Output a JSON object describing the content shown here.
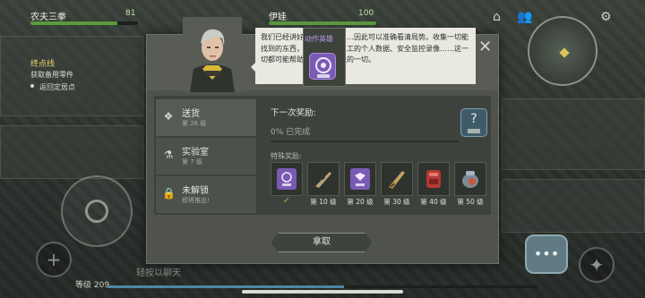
{
  "hud": {
    "player1_name": "农夫三拳",
    "player1_hp": "81",
    "player1_hp_fraction": 0.81,
    "player2_name": "伊娃",
    "player2_hp": "100",
    "player2_hp_fraction": 1.0,
    "quest_title": "终点线",
    "quest_sub": "获取备用零件",
    "quest_back": "返回定居点",
    "level": "等级 209",
    "chat_placeholder": "轻按以聊天"
  },
  "dialog": {
    "speech": "我们已经讲好了所有工作……因此可以准确看清局势。收集一切能找到的东西，研究完成、员工的个人数据、安全监控录像……这一切都可能帮助我们重现发生的一切。",
    "tooltip_label": "动作英雄",
    "close_icon": "close-icon",
    "tabs": [
      {
        "title": "送货",
        "sub": "第 26 级",
        "icon": "box-icon"
      },
      {
        "title": "实验室",
        "sub": "第 7 级",
        "icon": "flask-icon"
      },
      {
        "title": "未解锁",
        "sub": "即将推出!",
        "icon": "lock-icon"
      }
    ],
    "next_reward_label": "下一次奖励:",
    "progress_text": "0% 已完成",
    "progress_fraction": 0.0,
    "special_label": "特殊奖励:",
    "rewards": [
      {
        "label": "",
        "claimed": true,
        "icon": "purple-chip-icon"
      },
      {
        "label": "第 10 级",
        "claimed": false,
        "icon": "rifle-icon"
      },
      {
        "label": "第 20 级",
        "claimed": false,
        "icon": "purple-chip-icon"
      },
      {
        "label": "第 30 级",
        "claimed": false,
        "icon": "shotgun-icon"
      },
      {
        "label": "第 40 级",
        "claimed": false,
        "icon": "red-gear-icon"
      },
      {
        "label": "第 50 级",
        "claimed": false,
        "icon": "backpack-icon"
      }
    ],
    "check_mark": "✓",
    "take_button": "拿取"
  },
  "colors": {
    "accent_purple": "#7a5bb3",
    "hp_green": "#5a9a3d",
    "quest_yellow": "#e6d36a"
  }
}
